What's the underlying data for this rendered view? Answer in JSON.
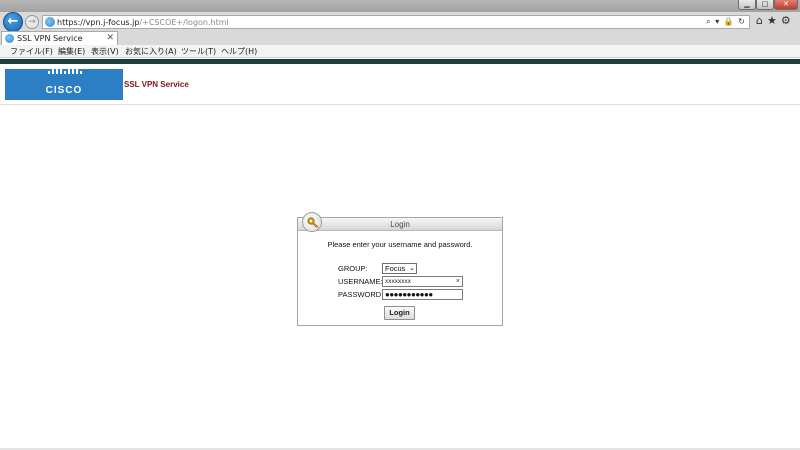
{
  "browser": {
    "window_controls": {
      "minimize": "▁",
      "maximize": "□",
      "close": "✕"
    },
    "back_icon": "back-arrow-icon",
    "forward_icon": "forward-arrow-icon",
    "address": {
      "prefix": "https://vpn.",
      "domain": "j-focus.jp",
      "path": "/+CSCOE+/logon.html"
    },
    "address_icons": "⌕ ▾ 🔒 ↻",
    "toolbar_icons": {
      "home": "⌂",
      "favorites": "★",
      "settings": "⚙"
    },
    "tab": {
      "label": "SSL VPN Service",
      "close": "✕"
    },
    "menu": [
      {
        "label": "ファイル(F)"
      },
      {
        "label": "編集(E)"
      },
      {
        "label": "表示(V)"
      },
      {
        "label": "お気に入り(A)"
      },
      {
        "label": "ツール(T)"
      },
      {
        "label": "ヘルプ(H)"
      }
    ]
  },
  "header": {
    "logo_text": "CISCO",
    "service_title": "SSL VPN Service",
    "logo_color": "#2d7fc5",
    "title_color": "#7a1818"
  },
  "login": {
    "title": "Login",
    "instruction": "Please enter your username and password.",
    "group_label": "GROUP:",
    "group_value": "Focus",
    "username_label": "USERNAME:",
    "username_value": "xxxxxxxx",
    "username_clear": "×",
    "password_label": "PASSWORD:",
    "password_value": "●●●●●●●●●●●",
    "button_label": "Login"
  }
}
